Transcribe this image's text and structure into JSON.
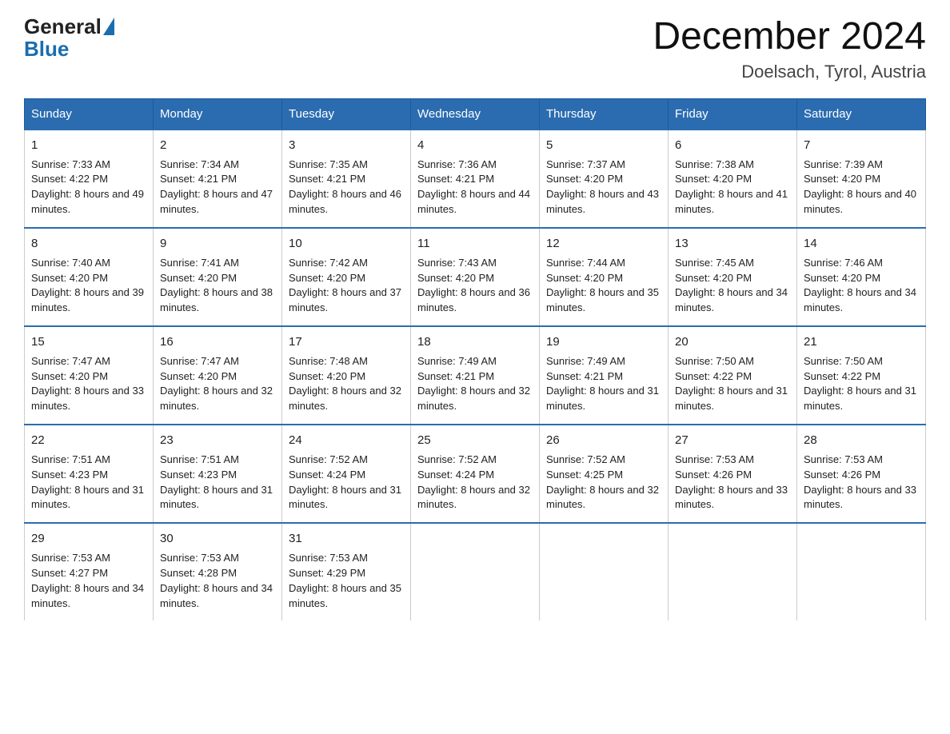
{
  "logo": {
    "general": "General",
    "blue": "Blue"
  },
  "title": "December 2024",
  "subtitle": "Doelsach, Tyrol, Austria",
  "days_of_week": [
    "Sunday",
    "Monday",
    "Tuesday",
    "Wednesday",
    "Thursday",
    "Friday",
    "Saturday"
  ],
  "weeks": [
    [
      {
        "day": "1",
        "sunrise": "7:33 AM",
        "sunset": "4:22 PM",
        "daylight": "8 hours and 49 minutes."
      },
      {
        "day": "2",
        "sunrise": "7:34 AM",
        "sunset": "4:21 PM",
        "daylight": "8 hours and 47 minutes."
      },
      {
        "day": "3",
        "sunrise": "7:35 AM",
        "sunset": "4:21 PM",
        "daylight": "8 hours and 46 minutes."
      },
      {
        "day": "4",
        "sunrise": "7:36 AM",
        "sunset": "4:21 PM",
        "daylight": "8 hours and 44 minutes."
      },
      {
        "day": "5",
        "sunrise": "7:37 AM",
        "sunset": "4:20 PM",
        "daylight": "8 hours and 43 minutes."
      },
      {
        "day": "6",
        "sunrise": "7:38 AM",
        "sunset": "4:20 PM",
        "daylight": "8 hours and 41 minutes."
      },
      {
        "day": "7",
        "sunrise": "7:39 AM",
        "sunset": "4:20 PM",
        "daylight": "8 hours and 40 minutes."
      }
    ],
    [
      {
        "day": "8",
        "sunrise": "7:40 AM",
        "sunset": "4:20 PM",
        "daylight": "8 hours and 39 minutes."
      },
      {
        "day": "9",
        "sunrise": "7:41 AM",
        "sunset": "4:20 PM",
        "daylight": "8 hours and 38 minutes."
      },
      {
        "day": "10",
        "sunrise": "7:42 AM",
        "sunset": "4:20 PM",
        "daylight": "8 hours and 37 minutes."
      },
      {
        "day": "11",
        "sunrise": "7:43 AM",
        "sunset": "4:20 PM",
        "daylight": "8 hours and 36 minutes."
      },
      {
        "day": "12",
        "sunrise": "7:44 AM",
        "sunset": "4:20 PM",
        "daylight": "8 hours and 35 minutes."
      },
      {
        "day": "13",
        "sunrise": "7:45 AM",
        "sunset": "4:20 PM",
        "daylight": "8 hours and 34 minutes."
      },
      {
        "day": "14",
        "sunrise": "7:46 AM",
        "sunset": "4:20 PM",
        "daylight": "8 hours and 34 minutes."
      }
    ],
    [
      {
        "day": "15",
        "sunrise": "7:47 AM",
        "sunset": "4:20 PM",
        "daylight": "8 hours and 33 minutes."
      },
      {
        "day": "16",
        "sunrise": "7:47 AM",
        "sunset": "4:20 PM",
        "daylight": "8 hours and 32 minutes."
      },
      {
        "day": "17",
        "sunrise": "7:48 AM",
        "sunset": "4:20 PM",
        "daylight": "8 hours and 32 minutes."
      },
      {
        "day": "18",
        "sunrise": "7:49 AM",
        "sunset": "4:21 PM",
        "daylight": "8 hours and 32 minutes."
      },
      {
        "day": "19",
        "sunrise": "7:49 AM",
        "sunset": "4:21 PM",
        "daylight": "8 hours and 31 minutes."
      },
      {
        "day": "20",
        "sunrise": "7:50 AM",
        "sunset": "4:22 PM",
        "daylight": "8 hours and 31 minutes."
      },
      {
        "day": "21",
        "sunrise": "7:50 AM",
        "sunset": "4:22 PM",
        "daylight": "8 hours and 31 minutes."
      }
    ],
    [
      {
        "day": "22",
        "sunrise": "7:51 AM",
        "sunset": "4:23 PM",
        "daylight": "8 hours and 31 minutes."
      },
      {
        "day": "23",
        "sunrise": "7:51 AM",
        "sunset": "4:23 PM",
        "daylight": "8 hours and 31 minutes."
      },
      {
        "day": "24",
        "sunrise": "7:52 AM",
        "sunset": "4:24 PM",
        "daylight": "8 hours and 31 minutes."
      },
      {
        "day": "25",
        "sunrise": "7:52 AM",
        "sunset": "4:24 PM",
        "daylight": "8 hours and 32 minutes."
      },
      {
        "day": "26",
        "sunrise": "7:52 AM",
        "sunset": "4:25 PM",
        "daylight": "8 hours and 32 minutes."
      },
      {
        "day": "27",
        "sunrise": "7:53 AM",
        "sunset": "4:26 PM",
        "daylight": "8 hours and 33 minutes."
      },
      {
        "day": "28",
        "sunrise": "7:53 AM",
        "sunset": "4:26 PM",
        "daylight": "8 hours and 33 minutes."
      }
    ],
    [
      {
        "day": "29",
        "sunrise": "7:53 AM",
        "sunset": "4:27 PM",
        "daylight": "8 hours and 34 minutes."
      },
      {
        "day": "30",
        "sunrise": "7:53 AM",
        "sunset": "4:28 PM",
        "daylight": "8 hours and 34 minutes."
      },
      {
        "day": "31",
        "sunrise": "7:53 AM",
        "sunset": "4:29 PM",
        "daylight": "8 hours and 35 minutes."
      },
      {
        "day": "",
        "sunrise": "",
        "sunset": "",
        "daylight": ""
      },
      {
        "day": "",
        "sunrise": "",
        "sunset": "",
        "daylight": ""
      },
      {
        "day": "",
        "sunrise": "",
        "sunset": "",
        "daylight": ""
      },
      {
        "day": "",
        "sunrise": "",
        "sunset": "",
        "daylight": ""
      }
    ]
  ]
}
